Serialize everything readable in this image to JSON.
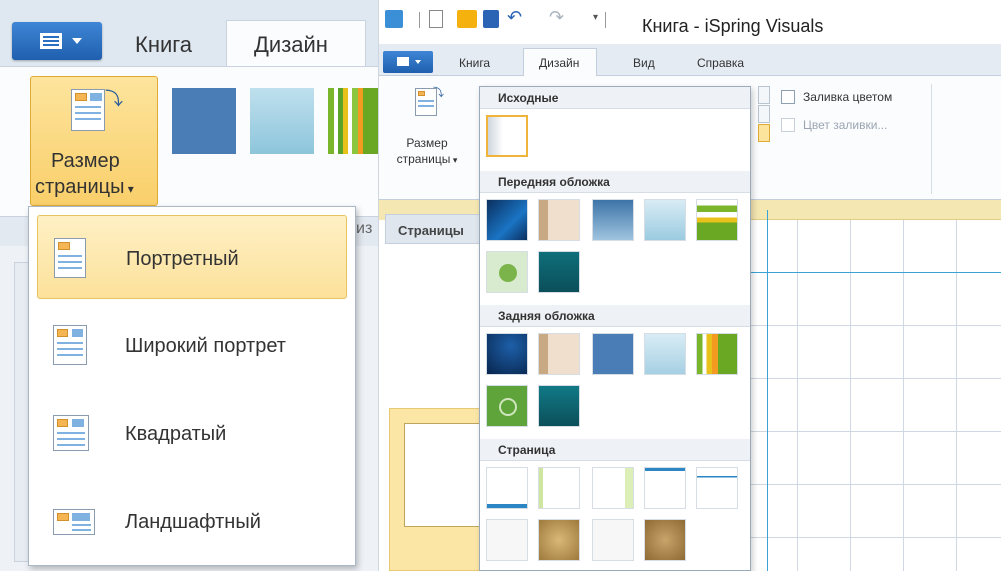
{
  "left": {
    "tabs": {
      "book": "Книга",
      "design": "Дизайн"
    },
    "page_size_button": {
      "line1": "Размер",
      "line2": "страницы"
    },
    "cut_label": "из",
    "menu": [
      {
        "label": "Портретный",
        "icon": "portrait-page-icon",
        "selected": true
      },
      {
        "label": "Широкий портрет",
        "icon": "wide-portrait-page-icon",
        "selected": false
      },
      {
        "label": "Квадратый",
        "icon": "square-page-icon",
        "selected": false
      },
      {
        "label": "Ландшафтный",
        "icon": "landscape-page-icon",
        "selected": false
      }
    ]
  },
  "right": {
    "window_title": "Книга - iSpring Visuals",
    "tabs": [
      "Книга",
      "Дизайн",
      "Вид",
      "Справка"
    ],
    "active_tab": "Дизайн",
    "page_size_button": {
      "line1": "Размер",
      "line2": "страницы"
    },
    "checkboxes": [
      {
        "label": "Заливка цветом",
        "checked": false,
        "enabled": true
      },
      {
        "label": "Цвет заливки...",
        "checked": false,
        "enabled": false
      }
    ],
    "panel_header": "Страницы",
    "gallery": {
      "sections": [
        {
          "title": "Исходные"
        },
        {
          "title": "Передняя обложка"
        },
        {
          "title": "Задняя обложка"
        },
        {
          "title": "Страница"
        }
      ]
    }
  },
  "colors": {
    "accent": "#f9cf6a",
    "brand_blue": "#2a6fc2",
    "guide": "#3aa3d6"
  }
}
